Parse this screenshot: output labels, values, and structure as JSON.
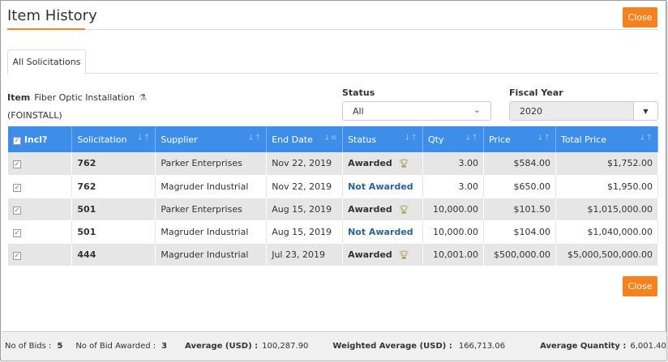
{
  "title": "Item History",
  "close_label": "Close",
  "tab": "All Solicitations",
  "item": {
    "label": "Item",
    "name": "Fiber Optic Installation",
    "code": "(FOINSTALL)"
  },
  "status_filter": {
    "label": "Status",
    "value": "All"
  },
  "fiscal_year": {
    "label": "Fiscal Year",
    "value": "2020"
  },
  "columns": [
    "Incl?",
    "Solicitation",
    "Supplier",
    "End Date",
    "Status",
    "Qty",
    "Price",
    "Total Price"
  ],
  "rows": [
    {
      "sol": "762",
      "supplier": "Parker Enterprises",
      "end": "Nov 22, 2019",
      "status": "Awarded",
      "awarded": true,
      "qty": "3.00",
      "price": "$584.00",
      "total": "$1,752.00"
    },
    {
      "sol": "762",
      "supplier": "Magruder Industrial",
      "end": "Nov 22, 2019",
      "status": "Not Awarded",
      "awarded": false,
      "qty": "3.00",
      "price": "$650.00",
      "total": "$1,950.00"
    },
    {
      "sol": "501",
      "supplier": "Parker Enterprises",
      "end": "Aug 15, 2019",
      "status": "Awarded",
      "awarded": true,
      "qty": "10,000.00",
      "price": "$101.50",
      "total": "$1,015,000.00"
    },
    {
      "sol": "501",
      "supplier": "Magruder Industrial",
      "end": "Aug 15, 2019",
      "status": "Not Awarded",
      "awarded": false,
      "qty": "10,000.00",
      "price": "$104.00",
      "total": "$1,040,000.00"
    },
    {
      "sol": "444",
      "supplier": "Magruder Industrial",
      "end": "Jul 23, 2019",
      "status": "Awarded",
      "awarded": true,
      "qty": "10,001.00",
      "price": "$500,000.00",
      "total": "$5,000,500,000.00"
    }
  ],
  "footer": {
    "bids_label": "No of Bids :",
    "bids": "5",
    "awarded_label": "No of Bid Awarded :",
    "awarded": "3",
    "avg_label": "Average (USD) :",
    "avg": "100,287.90",
    "wavg_label": "Weighted Average (USD) :",
    "wavg": "166,713.06",
    "avgq_label": "Average Quantity :",
    "avgq": "6,001.40"
  }
}
